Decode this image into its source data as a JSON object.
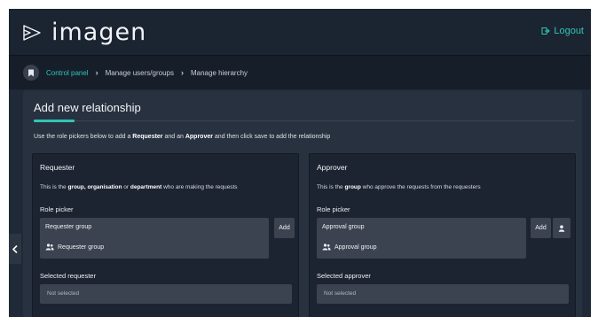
{
  "app": {
    "logo_text": "imagen",
    "logout_label": "Logout"
  },
  "breadcrumb": {
    "home_icon": "bookmark-icon",
    "items": [
      "Control panel",
      "Manage users/groups",
      "Manage hierarchy"
    ]
  },
  "panel": {
    "title": "Add new relationship",
    "intro_parts": [
      "Use the role pickers below to add a ",
      "Requester",
      " and an ",
      "Approver",
      " and then click save to add the relationship"
    ]
  },
  "requester": {
    "title": "Requester",
    "desc_parts": [
      "This is the ",
      "group, organisation",
      " or ",
      "department",
      " who are making the requests"
    ],
    "role_picker_label": "Role picker",
    "picker_value": "Requester group",
    "option_label": "Requester group",
    "add_label": "Add",
    "selected_label": "Selected requester",
    "selected_value": "Not selected"
  },
  "approver": {
    "title": "Approver",
    "desc_parts": [
      "This is the ",
      "group",
      " who approve the requests from the requesters"
    ],
    "role_picker_label": "Role picker",
    "picker_value": "Approval group",
    "option_label": "Approval group",
    "add_label": "Add",
    "selected_label": "Selected approver",
    "selected_value": "Not selected"
  },
  "colors": {
    "accent": "#2fc6b6",
    "background": "#1f2937",
    "panel": "#28313f",
    "card": "#1c2431",
    "input": "#3b4350"
  }
}
